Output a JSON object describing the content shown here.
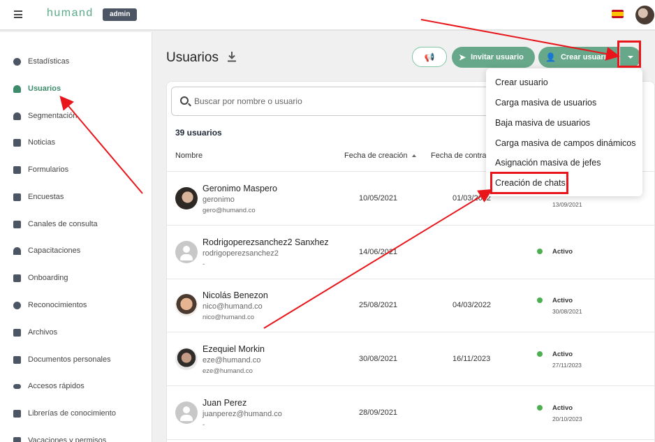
{
  "topbar": {
    "logo": "humand",
    "badge": "admin",
    "flag_colors": {
      "red": "#c60b1e",
      "yellow": "#ffc400"
    }
  },
  "sidebar": {
    "items": [
      {
        "label": "Estadísticas",
        "icon": "pie-chart-icon",
        "active": false
      },
      {
        "label": "Usuarios",
        "icon": "person-icon",
        "active": true
      },
      {
        "label": "Segmentación",
        "icon": "group-icon",
        "active": false
      },
      {
        "label": "Noticias",
        "icon": "news-icon",
        "active": false
      },
      {
        "label": "Formularios",
        "icon": "form-icon",
        "active": false
      },
      {
        "label": "Encuestas",
        "icon": "bar-chart-icon",
        "active": false
      },
      {
        "label": "Canales de consulta",
        "icon": "chat-icon",
        "active": false
      },
      {
        "label": "Capacitaciones",
        "icon": "graduation-cap-icon",
        "active": false
      },
      {
        "label": "Onboarding",
        "icon": "checklist-icon",
        "active": false
      },
      {
        "label": "Reconocimientos",
        "icon": "badge-icon",
        "active": false
      },
      {
        "label": "Archivos",
        "icon": "folder-icon",
        "active": false
      },
      {
        "label": "Documentos personales",
        "icon": "document-icon",
        "active": false
      },
      {
        "label": "Accesos rápidos",
        "icon": "link-icon",
        "active": false
      },
      {
        "label": "Librerías de conocimiento",
        "icon": "book-icon",
        "active": false
      },
      {
        "label": "Vacaciones y permisos",
        "icon": "calendar-icon",
        "active": false
      }
    ]
  },
  "header": {
    "title": "Usuarios",
    "invite_label": "Invitar usuario",
    "create_label": "Crear usuario"
  },
  "search": {
    "placeholder": "Buscar por nombre o usuario"
  },
  "table": {
    "count_label": "39 usuarios",
    "columns": [
      "Nombre",
      "Fecha de creación",
      "Fecha de contra"
    ],
    "rows": [
      {
        "name": "Geronimo Maspero",
        "username": "geronimo",
        "email": "gero@humand.co",
        "created": "10/05/2021",
        "contract": "01/03/2022",
        "status": "",
        "status_date": "13/09/2021",
        "avatar": "photo"
      },
      {
        "name": "Rodrigoperezsanchez2 Sanxhez",
        "username": "rodrigoperezsanchez2",
        "email": "-",
        "created": "14/06/2021",
        "contract": "",
        "status": "Activo",
        "status_date": "",
        "avatar": "placeholder"
      },
      {
        "name": "Nicolás Benezon",
        "username": "nico@humand.co",
        "email": "nico@humand.co",
        "created": "25/08/2021",
        "contract": "04/03/2022",
        "status": "Activo",
        "status_date": "30/08/2021",
        "avatar": "photo"
      },
      {
        "name": "Ezequiel Morkin",
        "username": "eze@humand.co",
        "email": "eze@humand.co",
        "created": "30/08/2021",
        "contract": "16/11/2023",
        "status": "Activo",
        "status_date": "27/11/2023",
        "avatar": "photo"
      },
      {
        "name": "Juan Perez",
        "username": "juanperez@humand.co",
        "email": "-",
        "created": "28/09/2021",
        "contract": "",
        "status": "Activo",
        "status_date": "20/10/2023",
        "avatar": "placeholder"
      }
    ]
  },
  "dropdown": {
    "items": [
      "Crear usuario",
      "Carga masiva de usuarios",
      "Baja masiva de usuarios",
      "Carga masiva de campos dinámicos",
      "Asignación masiva de jefes",
      "Creación de chats"
    ]
  },
  "colors": {
    "brand_green": "#67a88a",
    "active_green": "#3d8b6a",
    "status_green": "#4caf50",
    "annotation_red": "#e8161b"
  }
}
